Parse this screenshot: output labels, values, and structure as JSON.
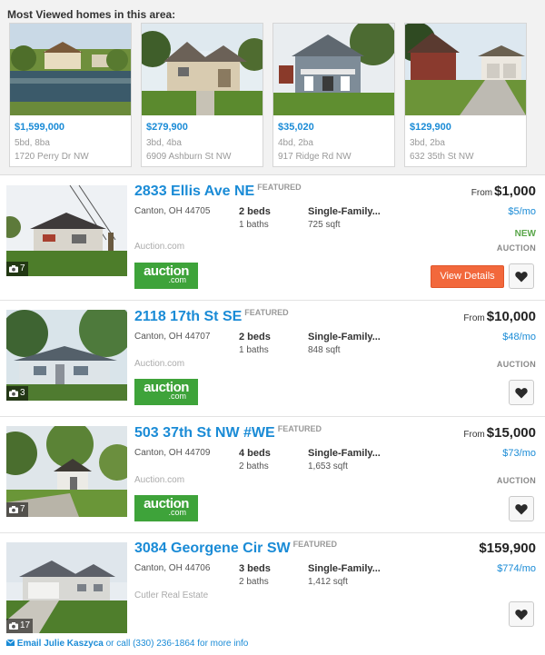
{
  "most_viewed": {
    "title": "Most Viewed homes in this area:",
    "cards": [
      {
        "price": "$1,599,000",
        "beds_baths": "5bd, 8ba",
        "address": "1720 Perry Dr NW"
      },
      {
        "price": "$279,900",
        "beds_baths": "3bd, 4ba",
        "address": "6909 Ashburn St NW"
      },
      {
        "price": "$35,020",
        "beds_baths": "4bd, 2ba",
        "address": "917 Ridge Rd NW"
      },
      {
        "price": "$129,900",
        "beds_baths": "3bd, 2ba",
        "address": "632 35th St NW"
      }
    ]
  },
  "listings": [
    {
      "address": "2833 Ellis Ave NE",
      "featured": "FEATURED",
      "city": "Canton, OH 44705",
      "beds": "2 beds",
      "baths": "1 baths",
      "type": "Single-Family...",
      "sqft": "725 sqft",
      "source": "Auction.com",
      "from": "From",
      "price": "$1,000",
      "monthly": "$5/mo",
      "badge": "NEW",
      "sale_type": "AUCTION",
      "photo_count": "7",
      "view_label": "View Details",
      "logo_main": "auction",
      "logo_sub": ".com"
    },
    {
      "address": "2118 17th St SE",
      "featured": "FEATURED",
      "city": "Canton, OH 44707",
      "beds": "2 beds",
      "baths": "1 baths",
      "type": "Single-Family...",
      "sqft": "848 sqft",
      "source": "Auction.com",
      "from": "From",
      "price": "$10,000",
      "monthly": "$48/mo",
      "sale_type": "AUCTION",
      "photo_count": "3",
      "logo_main": "auction",
      "logo_sub": ".com"
    },
    {
      "address": "503 37th St NW #WE",
      "featured": "FEATURED",
      "city": "Canton, OH 44709",
      "beds": "4 beds",
      "baths": "2 baths",
      "type": "Single-Family...",
      "sqft": "1,653 sqft",
      "source": "Auction.com",
      "from": "From",
      "price": "$15,000",
      "monthly": "$73/mo",
      "sale_type": "AUCTION",
      "photo_count": "7",
      "logo_main": "auction",
      "logo_sub": ".com"
    },
    {
      "address": "3084 Georgene Cir SW",
      "featured": "FEATURED",
      "city": "Canton, OH 44706",
      "beds": "3 beds",
      "baths": "2 baths",
      "type": "Single-Family...",
      "sqft": "1,412 sqft",
      "source": "Cutler Real Estate",
      "price": "$159,900",
      "monthly": "$774/mo",
      "photo_count": "17"
    }
  ],
  "contact": {
    "email_label": "Email Julie Kaszyca",
    "rest": " or call (330) 236-1864 for more info"
  },
  "icons": {
    "heart": "heart-icon",
    "camera": "camera-icon",
    "email": "envelope-icon"
  },
  "colors": {
    "link_blue": "#1a8bd6",
    "view_button": "#f2683c",
    "auction_green": "#3ea33a",
    "new_green": "#5aa64a"
  }
}
